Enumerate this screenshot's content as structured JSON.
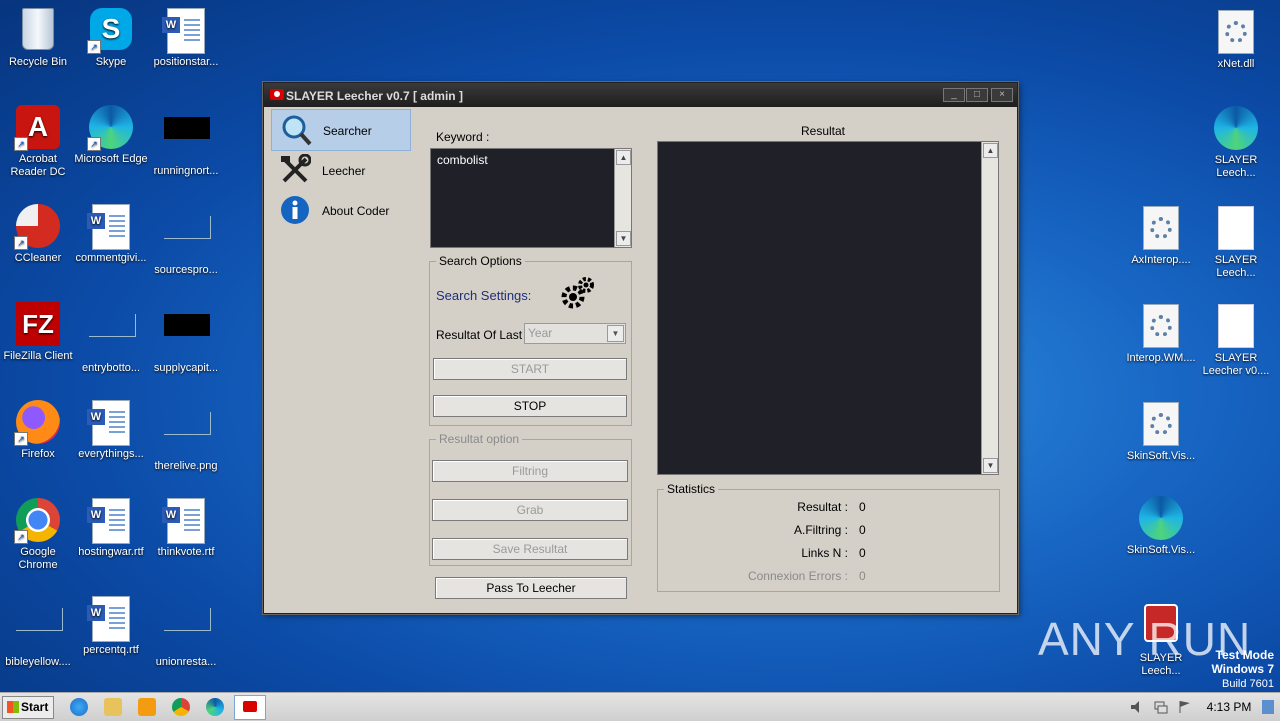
{
  "desktop": {
    "icons_left": [
      {
        "label": "Recycle Bin"
      },
      {
        "label": "Skype"
      },
      {
        "label": "positionstar..."
      },
      {
        "label": "Acrobat Reader DC"
      },
      {
        "label": "Microsoft Edge"
      },
      {
        "label": "runningnort..."
      },
      {
        "label": "CCleaner"
      },
      {
        "label": "commentgivi..."
      },
      {
        "label": "sourcespro..."
      },
      {
        "label": "FileZilla Client"
      },
      {
        "label": "entrybotto..."
      },
      {
        "label": "supplycapit..."
      },
      {
        "label": "Firefox"
      },
      {
        "label": "everythings..."
      },
      {
        "label": "therelive.png"
      },
      {
        "label": "Google Chrome"
      },
      {
        "label": "hostingwar.rtf"
      },
      {
        "label": "thinkvote.rtf"
      },
      {
        "label": "bibleyellow...."
      },
      {
        "label": "percentq.rtf"
      },
      {
        "label": "unionresta..."
      }
    ],
    "icons_right": [
      {
        "label": "xNet.dll"
      },
      {
        "label": "SLAYER Leech..."
      },
      {
        "label": "AxInterop...."
      },
      {
        "label": "SLAYER Leech..."
      },
      {
        "label": "Interop.WM...."
      },
      {
        "label": "SLAYER Leecher v0...."
      },
      {
        "label": "SkinSoft.Vis..."
      },
      {
        "label": "SkinSoft.Vis..."
      },
      {
        "label": "SLAYER Leech..."
      }
    ],
    "watermark": {
      "line1": "Test Mode",
      "line2": "Windows 7",
      "line3": "Build 7601"
    },
    "brand": "ANY RUN"
  },
  "window": {
    "title": "SLAYER Leecher v0.7 [ admin ]",
    "controls": {
      "min": "_",
      "max": "□",
      "close": "×"
    },
    "nav": [
      {
        "label": "Searcher",
        "icon": "magnifier-icon"
      },
      {
        "label": "Leecher",
        "icon": "tools-icon"
      },
      {
        "label": "About Coder",
        "icon": "info-icon"
      }
    ],
    "keyword": {
      "label": "Keyword :",
      "value": "combolist"
    },
    "search_options": {
      "legend": "Search Options",
      "settings_label": "Search Settings:",
      "resultat_of_last_label": "Resultat Of Last",
      "period_value": "Year",
      "start_label": "START",
      "stop_label": "STOP"
    },
    "resultat_option": {
      "legend": "Resultat option",
      "filtring_label": "Filtring",
      "grab_label": "Grab",
      "save_label": "Save Resultat"
    },
    "pass_label": "Pass To Leecher",
    "results": {
      "title": "Resultat"
    },
    "statistics": {
      "legend": "Statistics",
      "resultat_label": "Resultat :",
      "resultat_value": "0",
      "afiltring_label": "A.Filtring :",
      "afiltring_value": "0",
      "links_label": "Links N :",
      "links_value": "0",
      "errors_label": "Connexion Errors :",
      "errors_value": "0"
    }
  },
  "taskbar": {
    "start_label": "Start",
    "clock": "4:13 PM"
  },
  "colors": {
    "accent": "#b7cee8",
    "results_bg": "#202028",
    "titlebar": "#2a2a2a"
  }
}
